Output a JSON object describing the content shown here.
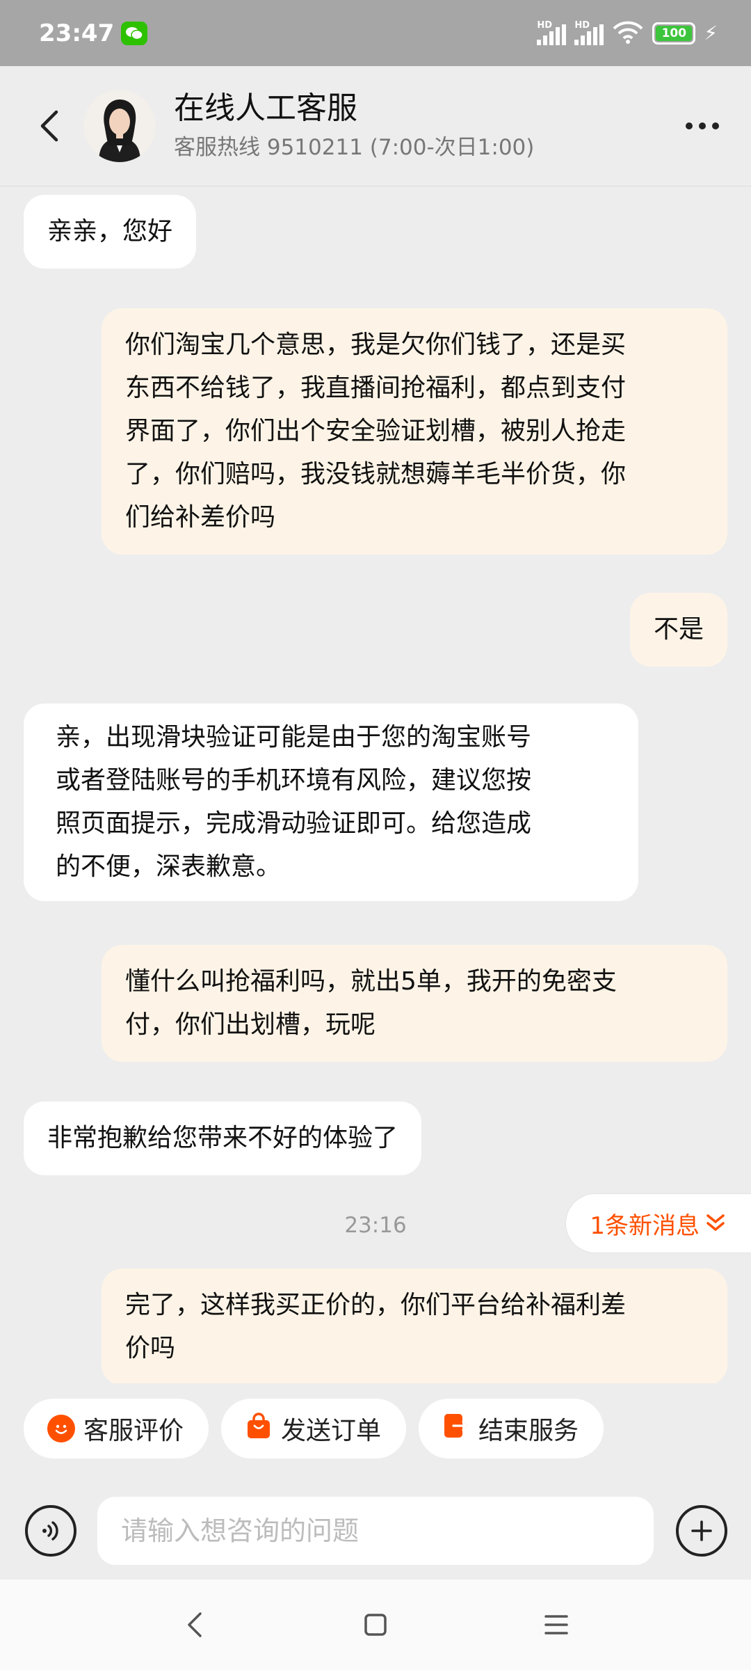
{
  "status_bar": {
    "time": "23:47",
    "signal1_label": "HD",
    "signal2_label": "HD",
    "battery": "100",
    "wechat_icon": "wechat-icon",
    "wifi_icon": "wifi-icon",
    "charging_icon": "bolt-icon"
  },
  "header": {
    "title": "在线人工客服",
    "subtitle": "客服热线 9510211 (7:00-次日1:00)"
  },
  "messages": [
    {
      "side": "in",
      "text": "亲亲，您好"
    },
    {
      "side": "out",
      "lines": [
        "你们淘宝几个意思，我是欠你们钱了，还是买",
        "东西不给钱了，我直播间抢福利，都点到支付",
        "界面了，你们出个安全验证划槽，被别人抢走",
        "了，你们赔吗，我没钱就想薅羊毛半价货，你",
        "们给补差价吗"
      ]
    },
    {
      "side": "out",
      "text": "不是"
    },
    {
      "side": "in",
      "lines": [
        "亲，出现滑块验证可能是由于您的淘宝账号",
        "或者登陆账号的手机环境有风险，建议您按",
        "照页面提示，完成滑动验证即可。给您造成",
        "的不便，深表歉意。"
      ]
    },
    {
      "side": "out",
      "lines": [
        "懂什么叫抢福利吗，就出5单，我开的免密支",
        "付，你们出划槽，玩呢"
      ]
    },
    {
      "side": "in",
      "text": "非常抱歉给您带来不好的体验了"
    },
    {
      "side": "out",
      "lines": [
        "完了，这样我买正价的，你们平台给补福利差",
        "价吗"
      ]
    }
  ],
  "timestamp": "23:16",
  "new_message_badge": "1条新消息",
  "quick_actions": [
    {
      "label": "客服评价",
      "icon": "smiley-icon"
    },
    {
      "label": "发送订单",
      "icon": "shopping-bag-icon"
    },
    {
      "label": "结束服务",
      "icon": "exit-icon"
    }
  ],
  "input": {
    "placeholder": "请输入想咨询的问题",
    "value": ""
  },
  "colors": {
    "accent": "#ff5000",
    "outgoing_bubble": "#fdf4e7",
    "incoming_bubble": "#ffffff",
    "background": "#ededed"
  }
}
